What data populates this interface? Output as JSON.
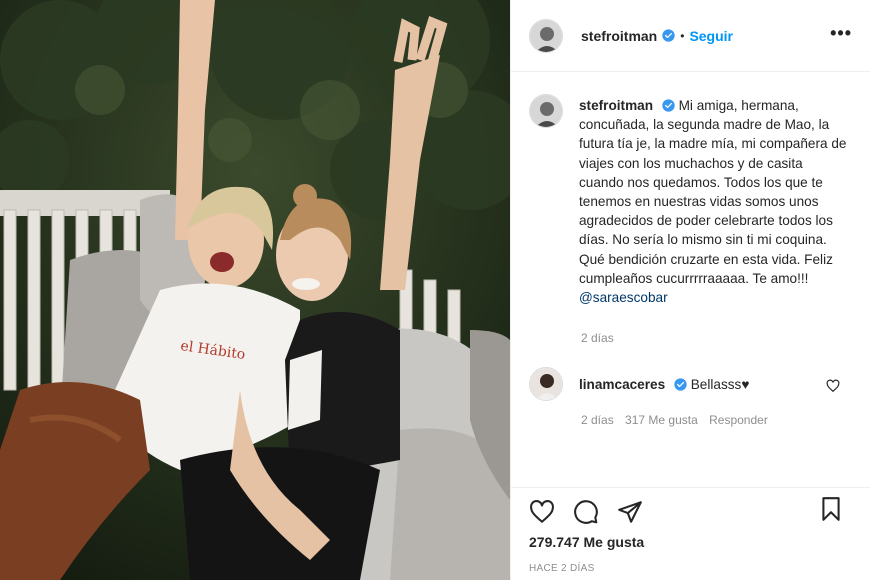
{
  "post": {
    "author": "stefroitman",
    "follow_label": "Seguir",
    "dot": "•",
    "more": "•••",
    "caption": "Mi amiga, hermana, concuñada, la segunda madre de Mao, la futura tía je, la madre mía, mi compañera de viajes con los muchachos y de casita cuando nos quedamos. Todos los que te tenemos en nuestras vidas somos unos agradecidos de poder celebrarte todos los días. No sería lo mismo sin ti mi coquina. Qué bendición cruzarte en esta vida. Feliz cumpleaños cucurrrrraaaaa. Te amo!!!",
    "mention": "@saraescobar",
    "caption_time": "2 días",
    "likes": "279.747 Me gusta",
    "date": "HACE 2 DÍAS"
  },
  "comments": [
    {
      "author": "linamcaceres",
      "text": "Bellasss♥",
      "time": "2 días",
      "likes": "317 Me gusta",
      "reply_label": "Responder"
    }
  ],
  "icons": {
    "verified": "verified-badge-icon",
    "like": "heart-icon",
    "comment": "comment-icon",
    "share": "paper-plane-icon",
    "save": "bookmark-icon"
  },
  "colors": {
    "link": "#0095f6",
    "mention": "#00376b",
    "muted": "#8e8e8e"
  }
}
